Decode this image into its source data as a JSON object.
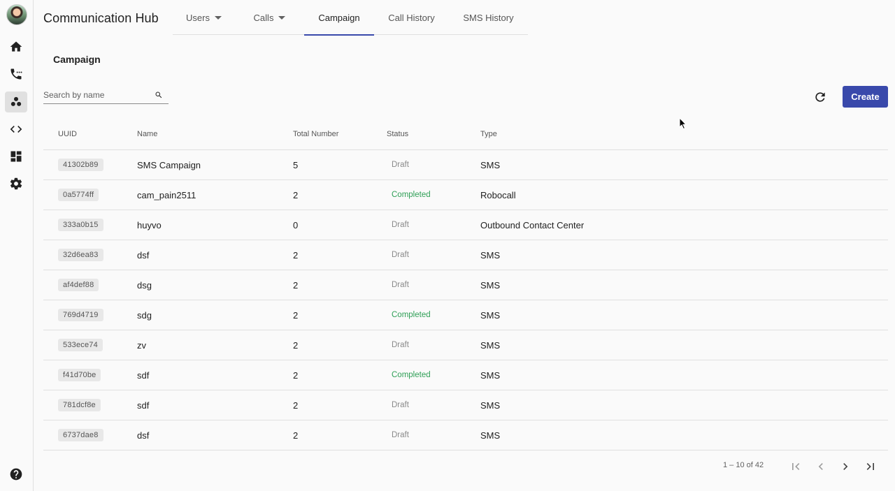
{
  "app": {
    "title": "Communication Hub"
  },
  "nav_rail": {
    "items": [
      {
        "name": "home",
        "icon": "home-icon"
      },
      {
        "name": "calls",
        "icon": "phone-icon"
      },
      {
        "name": "contacts",
        "icon": "group-icon",
        "active": true
      },
      {
        "name": "developer",
        "icon": "code-icon"
      },
      {
        "name": "dashboard",
        "icon": "dashboard-icon"
      },
      {
        "name": "settings",
        "icon": "gear-icon"
      }
    ],
    "help_icon": "help-icon"
  },
  "tabs": [
    {
      "label": "Users",
      "dropdown": true
    },
    {
      "label": "Calls",
      "dropdown": true
    },
    {
      "label": "Campaign",
      "active": true
    },
    {
      "label": "Call History"
    },
    {
      "label": "SMS History"
    }
  ],
  "section": {
    "title": "Campaign"
  },
  "search": {
    "placeholder": "Search by name",
    "value": ""
  },
  "toolbar": {
    "create_label": "Create"
  },
  "table": {
    "columns": [
      "UUID",
      "Name",
      "Total Number",
      "Status",
      "Type"
    ],
    "rows": [
      {
        "uuid": "41302b89",
        "name": "SMS Campaign",
        "total": "5",
        "status": "Draft",
        "type": "SMS"
      },
      {
        "uuid": "0a5774ff",
        "name": "cam_pain2511",
        "total": "2",
        "status": "Completed",
        "type": "Robocall"
      },
      {
        "uuid": "333a0b15",
        "name": "huyvo",
        "total": "0",
        "status": "Draft",
        "type": "Outbound Contact Center"
      },
      {
        "uuid": "32d6ea83",
        "name": "dsf",
        "total": "2",
        "status": "Draft",
        "type": "SMS"
      },
      {
        "uuid": "af4def88",
        "name": "dsg",
        "total": "2",
        "status": "Draft",
        "type": "SMS"
      },
      {
        "uuid": "769d4719",
        "name": "sdg",
        "total": "2",
        "status": "Completed",
        "type": "SMS"
      },
      {
        "uuid": "533ece74",
        "name": "zv",
        "total": "2",
        "status": "Draft",
        "type": "SMS"
      },
      {
        "uuid": "f41d70be",
        "name": "sdf",
        "total": "2",
        "status": "Completed",
        "type": "SMS"
      },
      {
        "uuid": "781dcf8e",
        "name": "sdf",
        "total": "2",
        "status": "Draft",
        "type": "SMS"
      },
      {
        "uuid": "6737dae8",
        "name": "dsf",
        "total": "2",
        "status": "Draft",
        "type": "SMS"
      }
    ]
  },
  "pagination": {
    "range": "1 – 10 of 42"
  },
  "colors": {
    "accent": "#3949ab",
    "completed": "#2e9e55",
    "draft": "#8a8a8a"
  }
}
